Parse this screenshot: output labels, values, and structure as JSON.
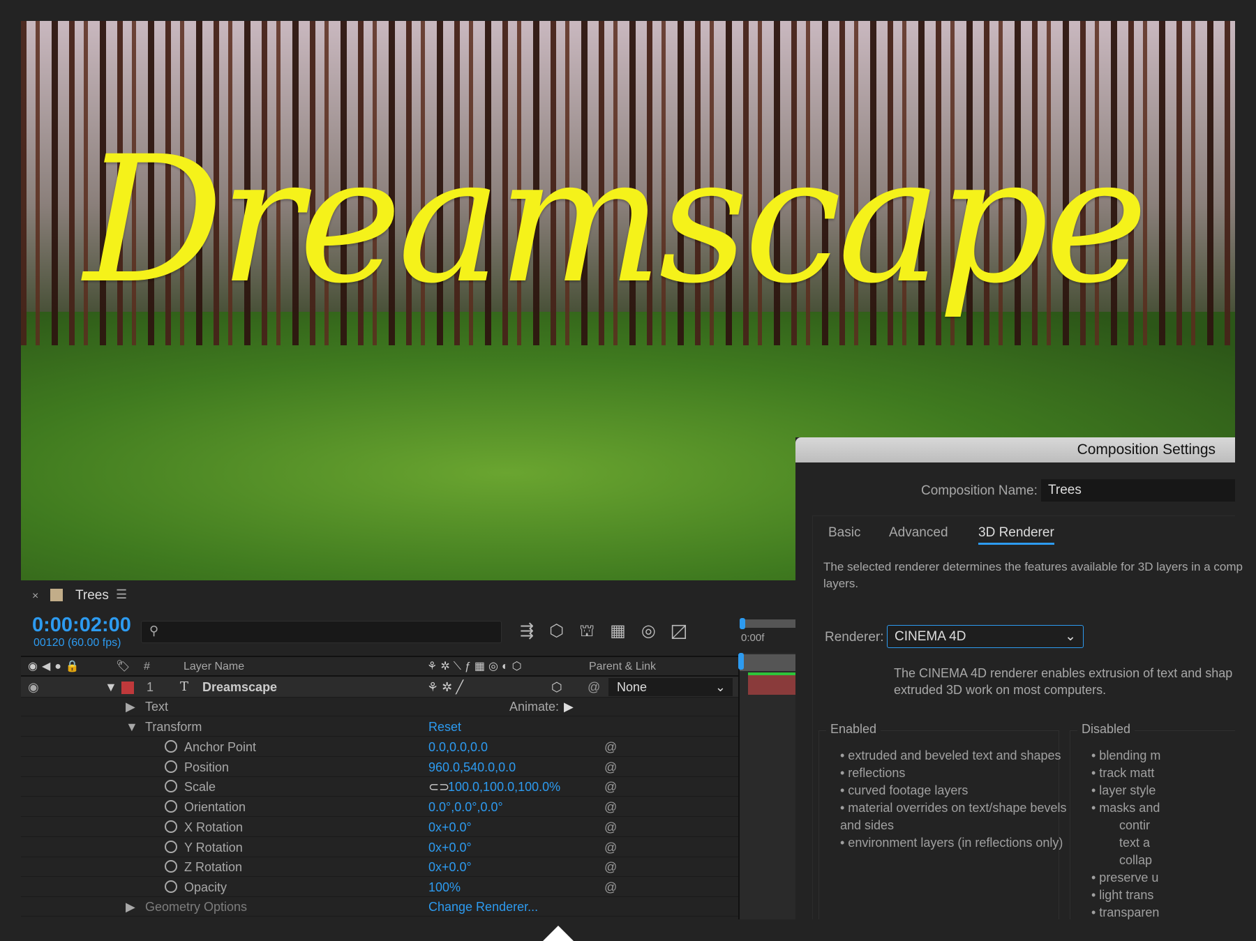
{
  "viewer": {
    "overlay_text": "Dreamscape",
    "text_color": "#f5f21a"
  },
  "timeline": {
    "close": "×",
    "comp_name": "Trees",
    "menu_icon": "hamburger-icon",
    "timecode": "0:00:02:00",
    "frame_info": "00120 (60.00 fps)",
    "search_placeholder": "",
    "ruler_label": "0:00f",
    "columns": {
      "hash": "#",
      "layer_name": "Layer Name",
      "parent": "Parent & Link"
    },
    "layer": {
      "index": "1",
      "type_icon": "T",
      "name": "Dreamscape",
      "parent": "None",
      "label_color": "#c0393b"
    },
    "text_group": "Text",
    "animate": "Animate:",
    "transform": "Transform",
    "reset": "Reset",
    "properties": [
      {
        "name": "Anchor Point",
        "value": "0.0,0.0,0.0"
      },
      {
        "name": "Position",
        "value": "960.0,540.0,0.0"
      },
      {
        "name": "Scale",
        "value": "100.0,100.0,100.0%"
      },
      {
        "name": "Orientation",
        "value": "0.0°,0.0°,0.0°"
      },
      {
        "name": "X Rotation",
        "value": "0x+0.0°"
      },
      {
        "name": "Y Rotation",
        "value": "0x+0.0°"
      },
      {
        "name": "Z Rotation",
        "value": "0x+0.0°"
      },
      {
        "name": "Opacity",
        "value": "100%"
      }
    ],
    "geometry": "Geometry Options",
    "change_renderer": "Change Renderer..."
  },
  "dialog": {
    "title": "Composition Settings",
    "comp_name_label": "Composition Name:",
    "comp_name_value": "Trees",
    "tabs": [
      "Basic",
      "Advanced",
      "3D Renderer"
    ],
    "active_tab": "3D Renderer",
    "intro": "The selected renderer determines the features available for 3D layers in a comp",
    "intro2": "layers.",
    "renderer_label": "Renderer:",
    "renderer_value": "CINEMA 4D",
    "renderer_desc1": "The CINEMA 4D renderer enables extrusion of text and shap",
    "renderer_desc2": "extruded 3D work on most computers.",
    "enabled_title": "Enabled",
    "enabled": [
      "• extruded and beveled text and shapes",
      "• reflections",
      "• curved footage layers",
      "• material overrides on text/shape bevels",
      "and sides",
      "• environment layers (in reflections only)"
    ],
    "disabled_title": "Disabled",
    "disabled": [
      "• blending m",
      "• track matt",
      "• layer style",
      "• masks and",
      "contir",
      "text a",
      "collap",
      "• preserve u",
      "• light trans",
      "• transparen"
    ]
  },
  "accent": "#2d9bf0"
}
